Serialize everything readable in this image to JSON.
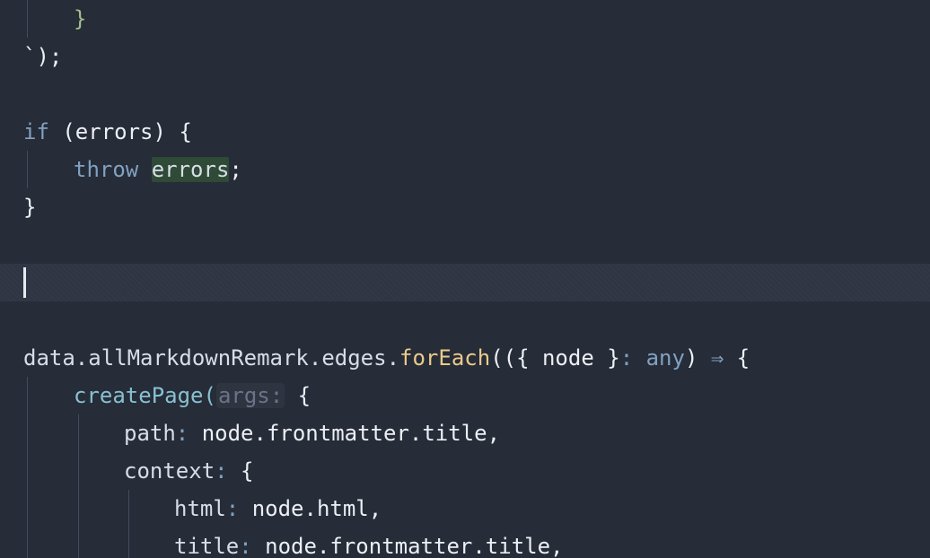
{
  "editor": {
    "lines": {
      "l1": {
        "brace": "}"
      },
      "l2": {
        "text": "`);"
      },
      "l3": {
        "kw_if": "if",
        "rest": " (errors) {"
      },
      "l4": {
        "kw_throw": "throw",
        "space": " ",
        "ident": "errors",
        "semi": ";"
      },
      "l5": {
        "brace": "}"
      },
      "l6": {
        "text": ""
      },
      "l7": {
        "obj": "data.allMarkdownRemark.edges.",
        "method": "forEach",
        "open": "(({ node }",
        "colon": ":",
        "type": " any",
        "close": ") ",
        "arrow": "⇒",
        "brace": " {"
      },
      "l8": {
        "fn": "createPage(",
        "hint": "args:",
        "brace": " {"
      },
      "l9": {
        "key": "path",
        "colon": ":",
        "value": " node.frontmatter.title,"
      },
      "l10": {
        "key": "context",
        "colon": ":",
        "value": " {"
      },
      "l11": {
        "key": "html",
        "colon": ":",
        "value": " node.html,"
      },
      "l12": {
        "key": "title",
        "colon": ":",
        "value": " node.frontmatter.title,"
      }
    }
  },
  "colors": {
    "background": "#262c38",
    "current_line": "#2f3542",
    "keyword": "#81a1c1",
    "function": "#88c0d0",
    "method": "#ebcb8b",
    "string_brace": "#a3be8c",
    "highlight": "#2f4a36"
  }
}
